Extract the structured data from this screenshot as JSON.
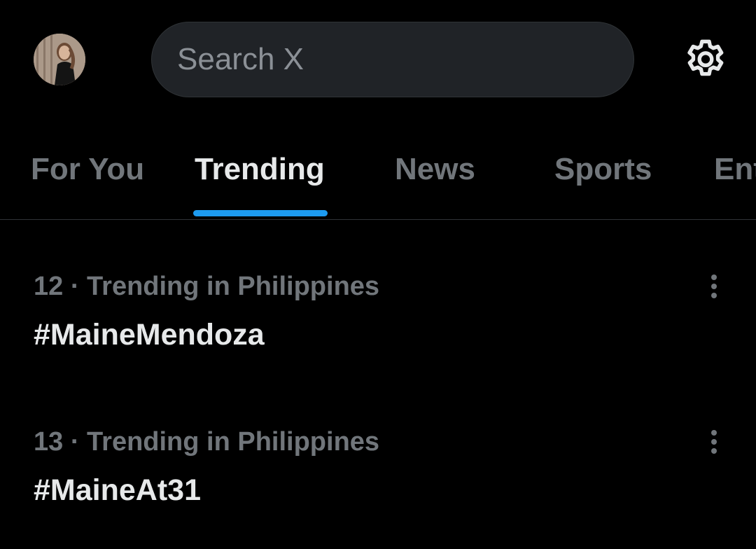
{
  "header": {
    "avatar_icon": "user-avatar",
    "search_placeholder": "Search X",
    "settings_icon": "gear-icon"
  },
  "tabs": [
    {
      "label": "For You",
      "active": false
    },
    {
      "label": "Trending",
      "active": true
    },
    {
      "label": "News",
      "active": false
    },
    {
      "label": "Sports",
      "active": false
    },
    {
      "label": "Entertainment",
      "active": false
    }
  ],
  "trends": [
    {
      "context": "12 · Trending in Philippines",
      "title": "#MaineMendoza",
      "more_icon": "more-vertical-icon"
    },
    {
      "context": "13 · Trending in Philippines",
      "title": "#MaineAt31",
      "more_icon": "more-vertical-icon"
    }
  ],
  "colors": {
    "background": "#000000",
    "accent": "#1d9bf0",
    "text_primary": "#e7e9ea",
    "text_secondary": "#71767b",
    "search_bg": "#202327"
  }
}
